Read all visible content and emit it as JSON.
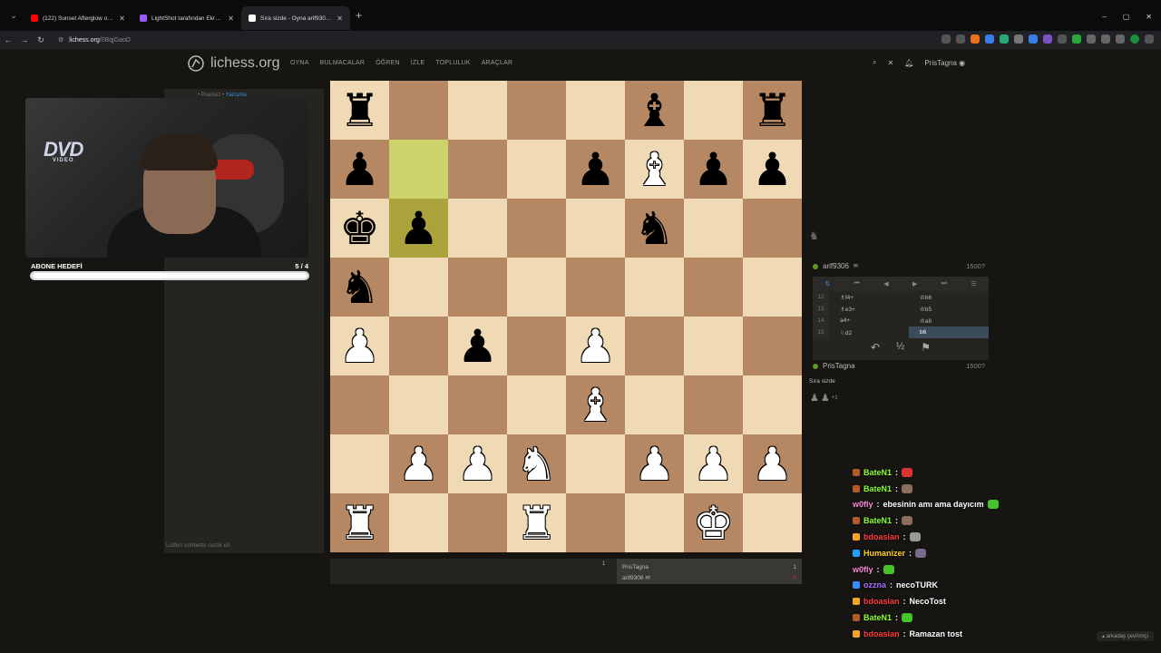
{
  "browser": {
    "tabs": [
      {
        "title": "(122) Sunset Afterglow on a Ta...",
        "color": "#ff0000"
      },
      {
        "title": "LightShot tarafından Ekran Gör...",
        "color": "#9b59ff"
      },
      {
        "title": "Sıra sizde - Oyna arif9306 • lich...",
        "color": "#ffffff",
        "active": true
      }
    ],
    "url": "lichess.org",
    "url_path": "/0BqjGaoD"
  },
  "site": {
    "logo_text": "lichess.org",
    "nav": [
      "OYNA",
      "BULMACALAR",
      "ÖĞREN",
      "İZLE",
      "TOPLULUK",
      "ARAÇLAR"
    ],
    "username": "PrisTagna"
  },
  "left": {
    "crumb": "• Puansız •",
    "crumb_link": "Yazışma",
    "chat_placeholder": "Lütfen sohbette nazik ol!"
  },
  "stream": {
    "dvd_logo": "DVD",
    "dvd_sub": "VIDEO",
    "sub_goal_label": "ABONE HEDEFİ",
    "sub_goal_value": "5 / 4",
    "sub_goal_fraction": 1.0
  },
  "board": {
    "rows": [
      [
        "bR",
        "",
        "",
        "",
        "",
        "bB",
        "",
        "bR"
      ],
      [
        "bP",
        "",
        "",
        "",
        "bP",
        "wB",
        "bP",
        "bP"
      ],
      [
        "bK",
        "bP",
        "",
        "",
        "",
        "bN",
        "",
        ""
      ],
      [
        "bN",
        "",
        "",
        "",
        "",
        "",
        "",
        ""
      ],
      [
        "wP",
        "",
        "bP",
        "",
        "wP",
        "",
        "",
        ""
      ],
      [
        "",
        "",
        "",
        "",
        "wB",
        "",
        "",
        ""
      ],
      [
        "",
        "wP",
        "wP",
        "wN",
        "",
        "wP",
        "wP",
        "wP"
      ],
      [
        "wR",
        "",
        "",
        "wR",
        "",
        "",
        "wK",
        ""
      ]
    ],
    "highlight": [
      [
        1,
        1
      ],
      [
        2,
        1
      ]
    ]
  },
  "under_board": {
    "round": "1",
    "white_name": "PrisTagna",
    "white_score": "1",
    "black_name": "arif9306",
    "black_score": "0"
  },
  "right": {
    "opponent": {
      "name": "arif9306",
      "rating": "1500?"
    },
    "me": {
      "name": "PrisTagna",
      "rating": "1500?"
    },
    "moves": [
      {
        "n": "12",
        "w": "♗f4+",
        "b": "♔b6"
      },
      {
        "n": "13",
        "w": "♗e3+",
        "b": "♔b5"
      },
      {
        "n": "14",
        "w": "a4+",
        "b": "♔a6"
      },
      {
        "n": "15",
        "w": "♘d2",
        "b": "b6"
      }
    ],
    "your_turn": "Sıra sizde",
    "captured_extra": "+1"
  },
  "chat": [
    {
      "user": "BateN1",
      "color": "#8cff3b",
      "msg": "",
      "badge": "#b35a2b",
      "emote": "#d33"
    },
    {
      "user": "BateN1",
      "color": "#8cff3b",
      "msg": "",
      "badge": "#b35a2b",
      "emote": "#8b6d5c"
    },
    {
      "user": "w0fly",
      "color": "#ff8ad8",
      "msg": "ebesinin amı ama dayıcım",
      "badge": "",
      "emote": "#45c42b"
    },
    {
      "user": "BateN1",
      "color": "#8cff3b",
      "msg": "",
      "badge": "#b35a2b",
      "emote": "#8b6d5c"
    },
    {
      "user": "bdoaslan",
      "color": "#ff3b3b",
      "msg": "",
      "badge": "#f5a623",
      "emote": "#999"
    },
    {
      "user": "Humanizer",
      "color": "#ffd12b",
      "msg": "",
      "badge": "#1ea0ff",
      "emote": "#7a6a8a"
    },
    {
      "user": "w0fly",
      "color": "#ff8ad8",
      "msg": "",
      "badge": "",
      "emote": "#45c42b"
    },
    {
      "user": "ozzna",
      "color": "#a970ff",
      "msg": "necoTURK",
      "badge": "#3b8bff",
      "emote": ""
    },
    {
      "user": "bdoaslan",
      "color": "#ff3b3b",
      "msg": "NecoTost",
      "badge": "#f5a623",
      "emote": ""
    },
    {
      "user": "BateN1",
      "color": "#8cff3b",
      "msg": "",
      "badge": "#b35a2b",
      "emote": "#45c42b"
    },
    {
      "user": "bdoaslan",
      "color": "#ff3b3b",
      "msg": "Ramazan tost",
      "badge": "#f5a623",
      "emote": ""
    }
  ],
  "online_text": "arkadaş çevrimiçi"
}
